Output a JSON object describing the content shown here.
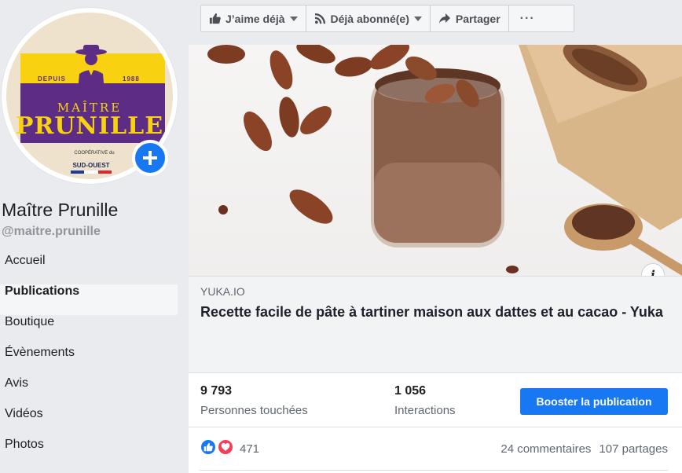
{
  "profile": {
    "logo": {
      "depuis": "DEPUIS",
      "year": "1988",
      "maitre": "MAÎTRE",
      "prunille": "PRUNILLE",
      "cooperative": "COOPÉRATIVE du",
      "sud_ouest": "SUD-OUEST"
    },
    "add_icon": "plus-icon",
    "name": "Maître Prunille",
    "handle": "@maitre.prunille"
  },
  "nav": {
    "items": [
      {
        "label": "Accueil",
        "active": false
      },
      {
        "label": "Publications",
        "active": true
      },
      {
        "label": "Boutique",
        "active": false
      },
      {
        "label": "Évènements",
        "active": false
      },
      {
        "label": "Avis",
        "active": false
      },
      {
        "label": "Vidéos",
        "active": false
      },
      {
        "label": "Photos",
        "active": false
      }
    ]
  },
  "actions": {
    "like_label": "J’aime déjà",
    "follow_label": "Déjà abonné(e)",
    "share_label": "Partager",
    "more_label": "···"
  },
  "post": {
    "image_icon": "info-icon",
    "info_label": "i",
    "link": {
      "domain": "YUKA.IO",
      "title": "Recette facile de pâte à tartiner maison aux dattes et au cacao - Yuka"
    },
    "stats": {
      "reach_value": "9 793",
      "reach_label": "Personnes touchées",
      "engagement_value": "1 056",
      "engagement_label": "Interactions",
      "boost_label": "Booster la publication"
    },
    "reactions": {
      "count": "471",
      "comments": "24 commentaires",
      "shares": "107 partages"
    }
  },
  "colors": {
    "accent": "#1877f2",
    "like": "#1877f2",
    "love": "#f33e58",
    "brand_yellow": "#f8d210",
    "brand_purple": "#5d2d85"
  }
}
